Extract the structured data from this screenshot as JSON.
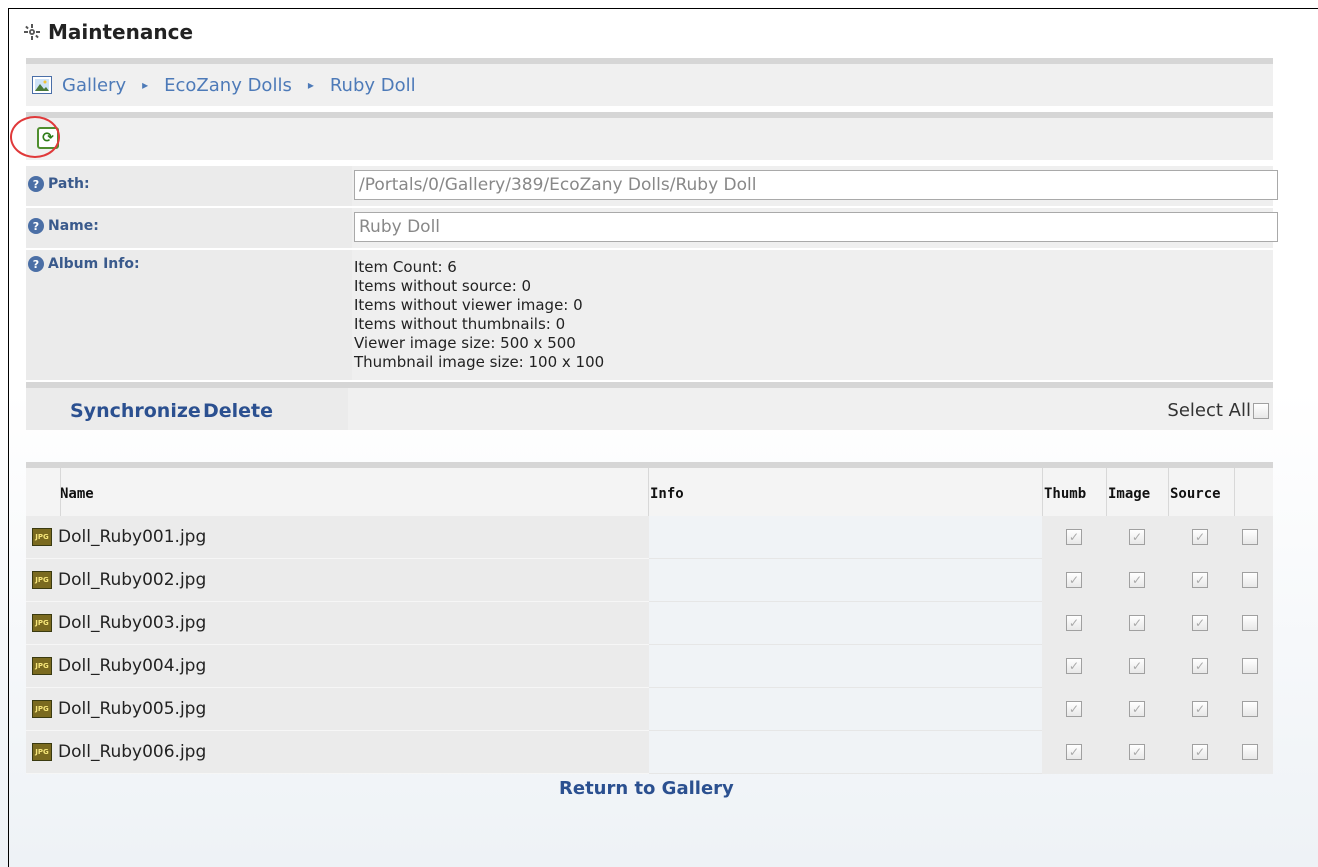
{
  "window": {
    "title": "Maintenance"
  },
  "breadcrumb": [
    "Gallery",
    "EcoZany Dolls",
    "Ruby Doll"
  ],
  "toolbar": {
    "refresh_icon": "refresh-icon"
  },
  "form": {
    "path_label": "Path:",
    "path_value": "/Portals/0/Gallery/389/EcoZany Dolls/Ruby Doll",
    "name_label": "Name:",
    "name_value": "Ruby Doll",
    "album_info_label": "Album Info:",
    "album_info": [
      "Item Count: 6",
      "Items without source:  0",
      "Items without viewer image: 0",
      "Items without thumbnails: 0",
      "Viewer image size: 500 x 500",
      "Thumbnail image size: 100 x 100"
    ]
  },
  "actions": {
    "synchronize_label": "Synchronize",
    "delete_label": "Delete",
    "select_all_label": "Select All"
  },
  "table": {
    "headers": {
      "name": "Name",
      "info": "Info",
      "thumb": "Thumb",
      "image": "Image",
      "source": "Source"
    },
    "rows": [
      {
        "name": "Doll_Ruby001.jpg"
      },
      {
        "name": "Doll_Ruby002.jpg"
      },
      {
        "name": "Doll_Ruby003.jpg"
      },
      {
        "name": "Doll_Ruby004.jpg"
      },
      {
        "name": "Doll_Ruby005.jpg"
      },
      {
        "name": "Doll_Ruby006.jpg"
      }
    ],
    "file_icon_text": "JPG"
  },
  "footer": {
    "return_label": "Return to Gallery"
  }
}
